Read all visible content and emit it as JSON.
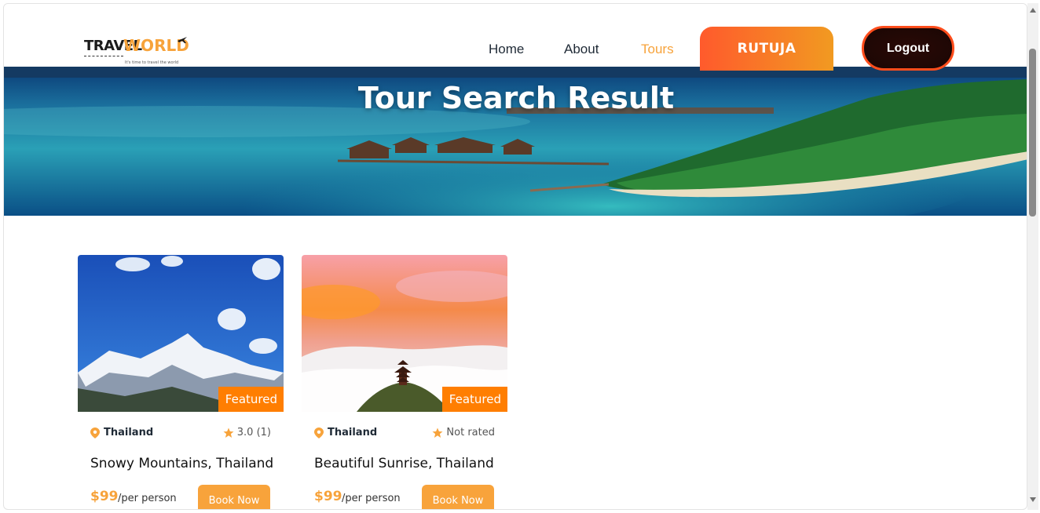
{
  "brand": {
    "logo_primary": "TRAVEL",
    "logo_secondary": "WORLD",
    "tagline": "It's time to travel the world",
    "accent_color": "#f7a33b"
  },
  "nav": {
    "home": "Home",
    "about": "About",
    "tours": "Tours",
    "active": "Tours"
  },
  "user": {
    "name": "RUTUJA",
    "logout_label": "Logout"
  },
  "hero": {
    "title": "Tour Search Result"
  },
  "tours": [
    {
      "location": "Thailand",
      "rating": "3.0 (1)",
      "title": "Snowy Mountains, Thailand",
      "price": "$99",
      "per": "/per person",
      "badge": "Featured",
      "book_label": "Book Now"
    },
    {
      "location": "Thailand",
      "rating": "Not rated",
      "title": "Beautiful Sunrise, Thailand",
      "price": "$99",
      "per": "/per person",
      "badge": "Featured",
      "book_label": "Book Now"
    }
  ]
}
